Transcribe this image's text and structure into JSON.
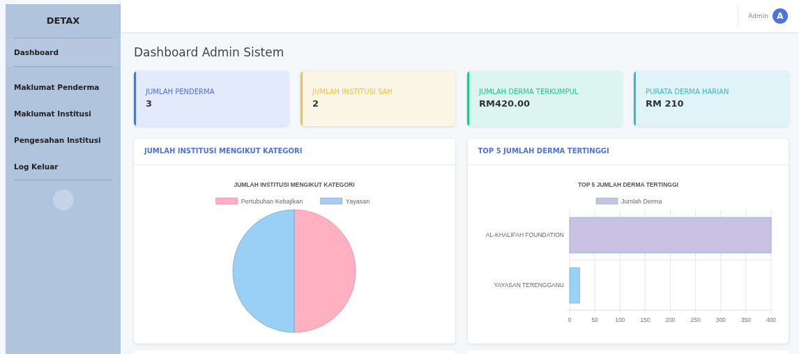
{
  "sidebar": {
    "brand": "DETAX",
    "items": [
      {
        "label": "Dashboard",
        "selected": true
      },
      {
        "label": "Maklumat Penderma",
        "selected": false
      },
      {
        "label": "Maklumat Institusi",
        "selected": false
      },
      {
        "label": "Pengesahan Institusi",
        "selected": false
      },
      {
        "label": "Log Keluar",
        "selected": false
      }
    ]
  },
  "topbar": {
    "user": "Admin",
    "avatar": "A"
  },
  "page_title": "Dashboard Admin Sistem",
  "stats": [
    {
      "label": "JUMLAH PENDERMA",
      "value": "3",
      "color": "#4e73df"
    },
    {
      "label": "JUMLAH INSTITUSI SAH",
      "value": "2",
      "color": "#f6c23e"
    },
    {
      "label": "JUMLAH DERMA TERKUMPUL",
      "value": "RM420.00",
      "color": "#1cc88a"
    },
    {
      "label": "PURATA DERMA HARIAN",
      "value": "RM 210",
      "color": "#36b9cc"
    }
  ],
  "panels": [
    {
      "title": "JUMLAH INSTITUSI MENGIKUT KATEGORI",
      "chart_data": {
        "type": "pie",
        "title": "JUMLAH INSTITUSI MENGIKUT KATEGORI",
        "categories": [
          "Pertubuhan Kebajikan",
          "Yayasan"
        ],
        "values": [
          50,
          50
        ],
        "colors": [
          "#ffb1c1",
          "#9ad0f5"
        ],
        "legend": "top"
      }
    },
    {
      "title": "TOP 5 JUMLAH DERMA TERTINGGI",
      "chart_data": {
        "type": "bar",
        "orientation": "horizontal",
        "title": "TOP 5 JUMLAH DERMA TERTINGGI",
        "categories": [
          "AL-KHALIFAH FOUNDATION",
          "YAYASAN TERENGGANU"
        ],
        "series": [
          {
            "name": "Jumlah Derma",
            "values": [
              400,
              20
            ]
          }
        ],
        "colors": [
          "#c9c1e3",
          "#9ad0f5"
        ],
        "legend": "top",
        "grid": true,
        "xlim": [
          0,
          400
        ],
        "xticks": [
          0,
          50,
          100,
          150,
          200,
          250,
          300,
          350,
          400
        ]
      }
    }
  ]
}
